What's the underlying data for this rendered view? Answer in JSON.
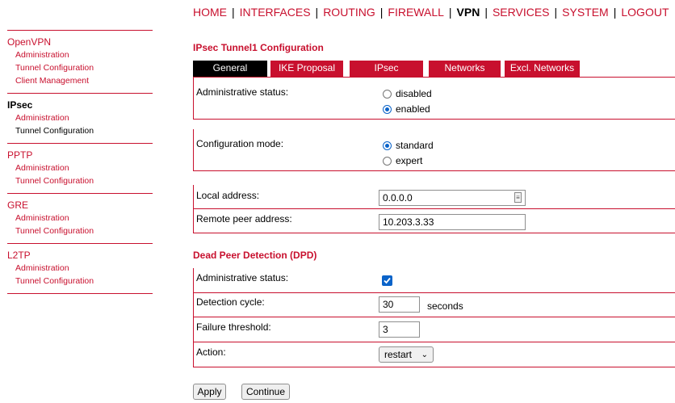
{
  "topnav": {
    "items": [
      "HOME",
      "INTERFACES",
      "ROUTING",
      "FIREWALL",
      "VPN",
      "SERVICES",
      "SYSTEM",
      "LOGOUT"
    ],
    "active": "VPN"
  },
  "sidebar": {
    "openvpn": {
      "title": "OpenVPN",
      "items": [
        "Administration",
        "Tunnel Configuration",
        "Client Management"
      ]
    },
    "ipsec": {
      "title": "IPsec",
      "items": [
        "Administration",
        "Tunnel Configuration"
      ]
    },
    "pptp": {
      "title": "PPTP",
      "items": [
        "Administration",
        "Tunnel Configuration"
      ]
    },
    "gre": {
      "title": "GRE",
      "items": [
        "Administration",
        "Tunnel Configuration"
      ]
    },
    "l2tp": {
      "title": "L2TP",
      "items": [
        "Administration",
        "Tunnel Configuration"
      ]
    }
  },
  "main": {
    "title": "IPsec Tunnel1 Configuration",
    "tabs": [
      "General",
      "IKE Proposal",
      "IPsec",
      "Networks",
      "Excl. Networks"
    ],
    "admin_status": {
      "label": "Administrative status:",
      "options": [
        "disabled",
        "enabled"
      ],
      "selected": "enabled"
    },
    "config_mode": {
      "label": "Configuration mode:",
      "options": [
        "standard",
        "expert"
      ],
      "selected": "standard"
    },
    "local_address": {
      "label": "Local address:",
      "value": "0.0.0.0"
    },
    "remote_peer": {
      "label": "Remote peer address:",
      "value": "10.203.3.33"
    },
    "dpd": {
      "title": "Dead Peer Detection (DPD)",
      "admin_status_label": "Administrative status:",
      "admin_status_checked": true,
      "cycle_label": "Detection cycle:",
      "cycle_value": "30",
      "cycle_unit": "seconds",
      "threshold_label": "Failure threshold:",
      "threshold_value": "3",
      "action_label": "Action:",
      "action_value": "restart"
    },
    "buttons": {
      "apply": "Apply",
      "continue": "Continue"
    }
  },
  "colors": {
    "accent": "#c8102e",
    "active_tab": "#000000",
    "checkbox": "#0a63c9"
  }
}
